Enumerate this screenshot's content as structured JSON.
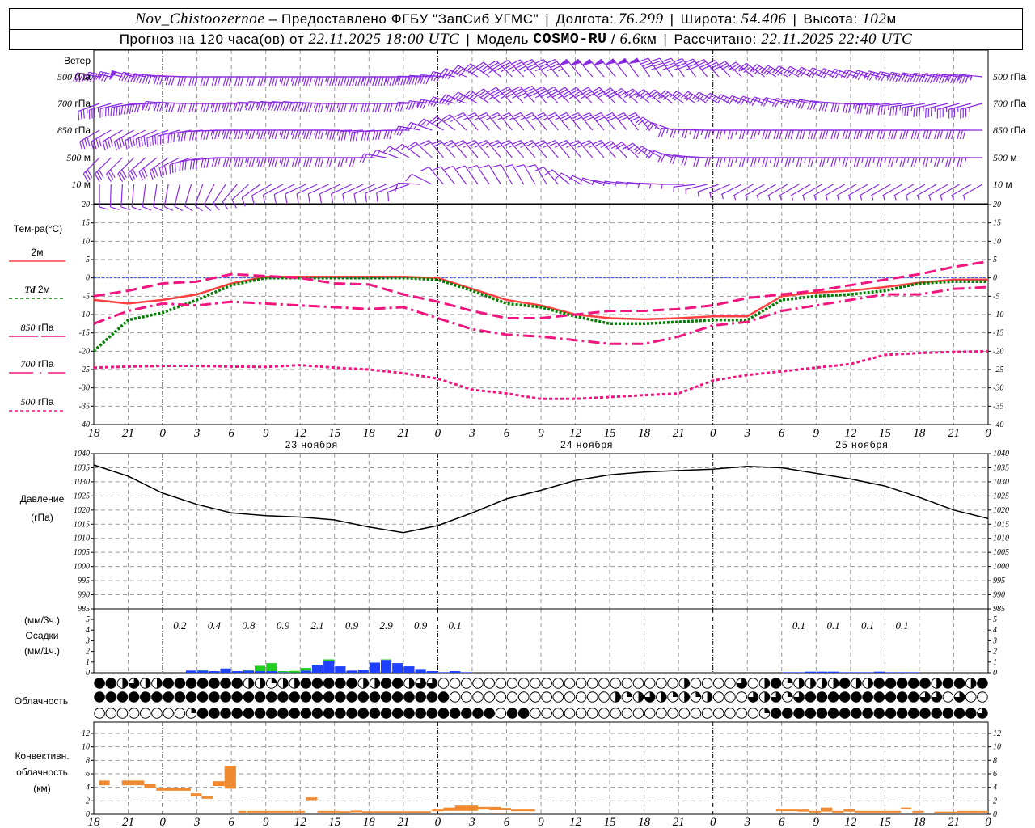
{
  "header": {
    "station": "Nov_Chistoozernoe",
    "provider": " – Предоставлено ФГБУ \"ЗапСиб УГМС\"",
    "lon_label": "Долгота: ",
    "lon": "76.299",
    "lat_label": "Широта: ",
    "lat": "54.406",
    "alt_label": "Высота: ",
    "alt": "102",
    "alt_unit": "м",
    "forecast_label": "Прогноз на 120 часа(ов) от ",
    "forecast_start": "22.11.2025 18:00 UTC",
    "model_label": "Модель ",
    "model": "COSMO-RU",
    "res_sep": " / ",
    "res": "6.6",
    "res_unit": "км",
    "calc_label": "Рассчитано: ",
    "calc_time": "22.11.2025 22:40 UTC",
    "separator": "|"
  },
  "time_axis": {
    "step_hours": 3,
    "hour_labels": [
      "18",
      "21",
      "0",
      "3",
      "6",
      "9",
      "12",
      "15",
      "18",
      "21",
      "0",
      "3",
      "6",
      "9",
      "12",
      "15",
      "18",
      "21",
      "0",
      "3",
      "6",
      "9",
      "12",
      "15",
      "18",
      "21",
      "0"
    ],
    "date_labels": [
      "23 ноября",
      "24 ноября",
      "25 ноября"
    ],
    "midnight_lead_hours": [
      6,
      30,
      54,
      78
    ]
  },
  "wind": {
    "title": "Ветер",
    "color": "#8a2be2",
    "levels": [
      {
        "num": "500",
        "unit": " гПа",
        "dir": [
          280,
          285,
          275,
          270,
          270,
          270,
          270,
          270,
          270,
          270,
          275,
          300,
          315,
          320,
          320,
          320,
          325,
          325,
          320,
          310,
          300,
          295,
          290,
          285,
          280,
          278,
          275
        ],
        "speed": [
          22,
          24,
          18,
          15,
          15,
          15,
          18,
          18,
          22,
          22,
          22,
          20,
          22,
          22,
          24,
          24,
          24,
          22,
          20,
          18,
          16,
          15,
          15,
          18,
          20,
          22,
          22
        ]
      },
      {
        "num": "700",
        "unit": " гПа",
        "dir": [
          250,
          260,
          275,
          270,
          270,
          275,
          275,
          270,
          270,
          270,
          280,
          300,
          315,
          320,
          315,
          315,
          310,
          305,
          300,
          290,
          285,
          280,
          270,
          265,
          260,
          255,
          255
        ],
        "speed": [
          18,
          20,
          18,
          14,
          18,
          18,
          20,
          18,
          15,
          15,
          18,
          20,
          22,
          22,
          22,
          20,
          18,
          16,
          14,
          12,
          12,
          14,
          16,
          18,
          18,
          18,
          18
        ]
      },
      {
        "num": "850",
        "unit": " гПа",
        "dir": [
          240,
          240,
          250,
          265,
          270,
          270,
          270,
          270,
          265,
          270,
          300,
          320,
          320,
          320,
          320,
          320,
          320,
          275,
          270,
          270,
          270,
          270,
          270,
          270,
          270,
          270,
          270
        ],
        "speed": [
          20,
          20,
          20,
          15,
          18,
          18,
          18,
          17,
          16,
          15,
          12,
          12,
          13,
          13,
          14,
          14,
          14,
          13,
          13,
          13,
          14,
          14,
          14,
          14,
          14,
          14,
          14
        ]
      },
      {
        "num": "500",
        "unit": " м",
        "dir": [
          225,
          225,
          235,
          260,
          270,
          270,
          270,
          270,
          270,
          300,
          320,
          320,
          320,
          320,
          320,
          320,
          310,
          280,
          270,
          270,
          270,
          270,
          270,
          270,
          270,
          270,
          270
        ],
        "speed": [
          15,
          15,
          15,
          15,
          16,
          17,
          16,
          15,
          10,
          8,
          10,
          12,
          12,
          12,
          12,
          12,
          12,
          10,
          10,
          12,
          12,
          12,
          12,
          12,
          12,
          12,
          12
        ]
      },
      {
        "num": "10",
        "unit": "  м",
        "dir": [
          180,
          185,
          190,
          200,
          220,
          240,
          245,
          245,
          245,
          250,
          320,
          325,
          330,
          330,
          300,
          280,
          275,
          270,
          250,
          240,
          240,
          240,
          240,
          240,
          240,
          240,
          240
        ],
        "speed": [
          6,
          6,
          6,
          6,
          6,
          5,
          5,
          5,
          5,
          5,
          5,
          6,
          6,
          5,
          4,
          3,
          3,
          3,
          3,
          3,
          3,
          3,
          3,
          3,
          3,
          3,
          3
        ]
      }
    ]
  },
  "chart_data": [
    {
      "type": "line",
      "ylabel": "Тем-ра(°C)",
      "ylim": [
        -40,
        20
      ],
      "yticks": [
        20,
        15,
        10,
        5,
        0,
        -5,
        -10,
        -15,
        -20,
        -25,
        -30,
        -35,
        -40
      ],
      "grid": true,
      "x_start": "22.11.2025 18:00 UTC",
      "x_step_hours": 3,
      "zero_line_color": "#3050ff",
      "series": [
        {
          "name": "2м",
          "color": "#ff4040",
          "style": "solid",
          "values": [
            -6,
            -7,
            -6,
            -4.5,
            -1.5,
            0.3,
            0.3,
            0.3,
            0.3,
            0.3,
            0,
            -3,
            -6,
            -7.5,
            -10,
            -11,
            -11.3,
            -11,
            -10.5,
            -10.5,
            -5,
            -4,
            -3.5,
            -2.5,
            -1.3,
            -0.5,
            -0.5
          ]
        },
        {
          "name_prefix": "Td",
          "name": "2м",
          "color": "#008000",
          "style": "dotted",
          "values": [
            -20,
            -11.5,
            -9.5,
            -6,
            -2,
            0,
            0,
            0,
            0,
            0,
            -0.5,
            -3.5,
            -7,
            -8,
            -10.5,
            -12.5,
            -12.5,
            -12,
            -11.5,
            -11.5,
            -6,
            -5,
            -4.5,
            -3.5,
            -1.5,
            -1,
            -1
          ]
        },
        {
          "name_num": "850",
          "name": "гПа",
          "color": "#f0157f",
          "style": "longdash",
          "values": [
            -5,
            -3.5,
            -1.5,
            -1,
            1,
            0.5,
            0,
            -1.5,
            -1.8,
            -4.5,
            -6.5,
            -9,
            -11,
            -11,
            -10,
            -9,
            -9,
            -8.5,
            -7.5,
            -5.5,
            -4.5,
            -3.5,
            -2,
            -0.5,
            1,
            3,
            4.5
          ]
        },
        {
          "name_num": "700",
          "name": "гПа",
          "color": "#f0157f",
          "style": "dashdot",
          "values": [
            -12.5,
            -9,
            -7,
            -7.5,
            -6.5,
            -7,
            -7.5,
            -8,
            -8.5,
            -8,
            -11,
            -14,
            -15.5,
            -16,
            -17,
            -18,
            -18,
            -16,
            -13,
            -12,
            -9,
            -7.5,
            -6,
            -4.5,
            -4.5,
            -3,
            -2.5
          ]
        },
        {
          "name_num": "500",
          "name": "гПа",
          "color": "#f0157f",
          "style": "dot",
          "values": [
            -24.5,
            -24.2,
            -24,
            -24,
            -24.2,
            -24.3,
            -23.8,
            -24.5,
            -25,
            -26,
            -27.5,
            -30.5,
            -31.5,
            -33,
            -33,
            -32.5,
            -32,
            -31.5,
            -28,
            -26.5,
            -25.5,
            -24.5,
            -23.5,
            -21,
            -20.5,
            -20.2,
            -20
          ]
        }
      ]
    },
    {
      "type": "line",
      "ylabel": "Давление",
      "yunit": "(гПа)",
      "ylim": [
        985,
        1040
      ],
      "yticks": [
        1040,
        1035,
        1030,
        1025,
        1020,
        1015,
        1010,
        1005,
        1000,
        995,
        990,
        985
      ],
      "grid": true,
      "x_start": "22.11.2025 18:00 UTC",
      "x_step_hours": 3,
      "series": [
        {
          "color": "#000000",
          "values": [
            1036,
            1032,
            1026,
            1022,
            1019,
            1018,
            1017.5,
            1016.5,
            1014,
            1012,
            1014.5,
            1019,
            1024,
            1027,
            1030.5,
            1032.5,
            1033.5,
            1034,
            1034.5,
            1035.5,
            1035,
            1033,
            1031,
            1028.5,
            1024.5,
            1020,
            1017
          ]
        }
      ]
    },
    {
      "type": "bar",
      "ylabel_top": "(мм/3ч.)",
      "ylabel": "Осадки",
      "ylabel_bottom": "(мм/1ч.)",
      "ylim": [
        0,
        5
      ],
      "yticks": [
        5,
        4,
        3,
        2,
        1,
        0
      ],
      "x_start": "22.11.2025 18:00 UTC",
      "x_step_hours": 1,
      "stacked": true,
      "series": [
        {
          "color": "#2040ff",
          "values": [
            0,
            0,
            0,
            0,
            0,
            0,
            0,
            0,
            0.2,
            0.2,
            0.15,
            0.4,
            0.15,
            0.2,
            0.15,
            0.15,
            0.05,
            0.02,
            0.2,
            0.7,
            1.1,
            0.6,
            0.2,
            0.3,
            0.95,
            1.2,
            0.9,
            0.6,
            0.35,
            0.15,
            0.05,
            0.15,
            0.05,
            0,
            0,
            0,
            0,
            0,
            0,
            0,
            0,
            0,
            0,
            0,
            0,
            0,
            0,
            0,
            0,
            0,
            0,
            0,
            0,
            0,
            0,
            0,
            0,
            0,
            0,
            0,
            0.05,
            0.05,
            0.1,
            0.1,
            0.1,
            0.05,
            0.05,
            0.05,
            0.1,
            0.05,
            0.05,
            0.05,
            0,
            0,
            0,
            0,
            0,
            0
          ]
        },
        {
          "color": "#20d020",
          "values": [
            0,
            0,
            0,
            0,
            0,
            0,
            0,
            0,
            0,
            0.05,
            0,
            0,
            0,
            0.05,
            0.5,
            0.75,
            0.1,
            0.15,
            0.25,
            0.05,
            0.15,
            0,
            0,
            0,
            0,
            0.05,
            0,
            0,
            0,
            0,
            0,
            0,
            0,
            0,
            0,
            0,
            0,
            0,
            0,
            0,
            0,
            0,
            0,
            0,
            0,
            0,
            0,
            0,
            0,
            0,
            0,
            0,
            0,
            0,
            0,
            0,
            0,
            0,
            0,
            0,
            0,
            0,
            0,
            0,
            0,
            0,
            0,
            0,
            0,
            0,
            0,
            0,
            0,
            0,
            0,
            0,
            0,
            0
          ]
        }
      ],
      "totals_3h": [
        {
          "lead_hours_from": 6,
          "label": "0.2"
        },
        {
          "lead_hours_from": 9,
          "label": "0.4"
        },
        {
          "lead_hours_from": 12,
          "label": "0.8"
        },
        {
          "lead_hours_from": 15,
          "label": "0.9"
        },
        {
          "lead_hours_from": 18,
          "label": "2.1"
        },
        {
          "lead_hours_from": 21,
          "label": "0.9"
        },
        {
          "lead_hours_from": 24,
          "label": "2.9"
        },
        {
          "lead_hours_from": 27,
          "label": "0.9"
        },
        {
          "lead_hours_from": 30,
          "label": "0.1"
        },
        {
          "lead_hours_from": 60,
          "label": "0.1"
        },
        {
          "lead_hours_from": 63,
          "label": "0.1"
        },
        {
          "lead_hours_from": 66,
          "label": "0.1"
        },
        {
          "lead_hours_from": 69,
          "label": "0.1"
        }
      ]
    },
    {
      "type": "table",
      "ylabel": "Облачность",
      "x_step_hours": 1,
      "encoding": "0 clear, 1 quarter, 2 half, 3 three-quarter, 4 overcast",
      "rows": [
        "442322444444422122444442244233000000000000000000000200003024122224224444424424",
        "444444444444444444444444444444400000000000000212321212000323134444444444330300",
        "000000001444444444444444444444444440440000000000000000000014444444444444444443"
      ]
    },
    {
      "type": "bar",
      "ylabel": "Конвективн.",
      "ylabel2": "облачность",
      "yunit": "(км)",
      "ylim": [
        0,
        13.7
      ],
      "yticks": [
        12,
        10,
        8,
        6,
        4,
        2,
        0
      ],
      "grid": true,
      "color": "#f08a30",
      "bars_lead_hours_base_top_km": [
        [
          0.46,
          1.38,
          4.3,
          5.0
        ],
        [
          2.45,
          4.4,
          4.3,
          5.0
        ],
        [
          4.4,
          5.4,
          3.9,
          4.5
        ],
        [
          5.45,
          8.45,
          3.5,
          3.9
        ],
        [
          8.45,
          9.4,
          2.7,
          3.1
        ],
        [
          9.4,
          10.4,
          2.3,
          2.7
        ],
        [
          10.4,
          11.4,
          4.2,
          4.9
        ],
        [
          11.4,
          12.4,
          3.8,
          7.2
        ],
        [
          12.6,
          13.3,
          0.4,
          0.5
        ],
        [
          13.4,
          17.4,
          0.4,
          0.5
        ],
        [
          17.5,
          18.4,
          0.4,
          0.5
        ],
        [
          18.5,
          19.5,
          2.1,
          2.5
        ],
        [
          19.5,
          21.4,
          0.4,
          0.5
        ],
        [
          21.4,
          22.4,
          0.35,
          0.45
        ],
        [
          22.4,
          23.4,
          0.4,
          0.55
        ],
        [
          23.4,
          29.4,
          0.35,
          0.45
        ],
        [
          29.5,
          30.5,
          0.5,
          0.7
        ],
        [
          30.5,
          31.5,
          0.5,
          1.0
        ],
        [
          31.5,
          33.5,
          0.5,
          1.3
        ],
        [
          33.5,
          34.5,
          0.7,
          1.1
        ],
        [
          34.5,
          35.5,
          0.6,
          1.1
        ],
        [
          35.5,
          36.4,
          0.6,
          0.95
        ],
        [
          36.4,
          38.5,
          0.5,
          0.7
        ],
        [
          59.5,
          61.4,
          0.6,
          0.7
        ],
        [
          61.4,
          62.4,
          0.4,
          0.7
        ],
        [
          62.4,
          63.4,
          0.4,
          0.5
        ],
        [
          63.4,
          64.4,
          0.4,
          1.0
        ],
        [
          64.4,
          65.4,
          0.4,
          0.5
        ],
        [
          65.4,
          66.4,
          0.4,
          0.8
        ],
        [
          66.4,
          70.4,
          0.4,
          0.5
        ],
        [
          70.4,
          71.3,
          0.8,
          1.0
        ],
        [
          71.4,
          72.4,
          0.4,
          0.5
        ],
        [
          73.3,
          75.3,
          0.3,
          0.4
        ],
        [
          75.3,
          76.3,
          0.4,
          0.5
        ],
        [
          76.3,
          77.3,
          0.3,
          0.5
        ],
        [
          77.3,
          78,
          0.4,
          0.5
        ]
      ]
    }
  ]
}
